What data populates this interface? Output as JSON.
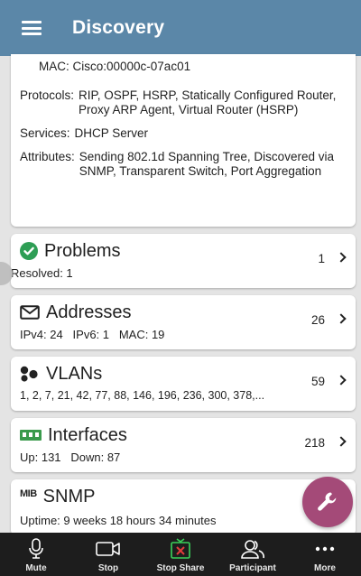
{
  "header": {
    "title": "Discovery",
    "menu_icon": "hamburger-icon"
  },
  "details": {
    "mac": "MAC: Cisco:00000c-07ac01",
    "protocols_label": "Protocols:",
    "protocols_value": "RIP, OSPF, HSRP, Statically Configured Router, Proxy ARP Agent, Virtual Router (HSRP)",
    "services_label": "Services:",
    "services_value": "DHCP Server",
    "attributes_label": "Attributes:",
    "attributes_value": "Sending 802.1d Spanning Tree, Discovered via SNMP, Transparent Switch, Port Aggregation"
  },
  "cards": {
    "problems": {
      "title": "Problems",
      "sub": "Resolved: 1",
      "count": "1",
      "icon": "check-circle-icon",
      "icon_color": "#2e9e55"
    },
    "addresses": {
      "title": "Addresses",
      "sub": "IPv4: 24   IPv6: 1   MAC: 19",
      "count": "26",
      "icon": "mail-icon"
    },
    "vlans": {
      "title": "VLANs",
      "sub": "1, 2, 7, 21, 42, 77, 88, 146, 196, 236, 300, 378,...",
      "count": "59",
      "icon": "vlan-dots-icon"
    },
    "interfaces": {
      "title": "Interfaces",
      "sub": "Up: 131   Down: 87",
      "count": "218",
      "icon": "ethernet-port-icon",
      "icon_color": "#3a9a4c"
    },
    "snmp": {
      "title": "SNMP",
      "sub": "Uptime: 9 weeks 18 hours 34 minutes",
      "icon": "mib-icon",
      "icon_text": "MIB"
    }
  },
  "fab": {
    "icon": "wrench-icon",
    "color": "#a44a78"
  },
  "meeting_bar": {
    "buttons": [
      {
        "label": "Mute",
        "icon": "microphone-icon"
      },
      {
        "label": "Stop",
        "icon": "video-camera-icon"
      },
      {
        "label": "Stop Share",
        "icon": "stop-share-icon"
      },
      {
        "label": "Participant",
        "icon": "participants-icon"
      },
      {
        "label": "More",
        "icon": "more-dots-icon"
      }
    ]
  }
}
